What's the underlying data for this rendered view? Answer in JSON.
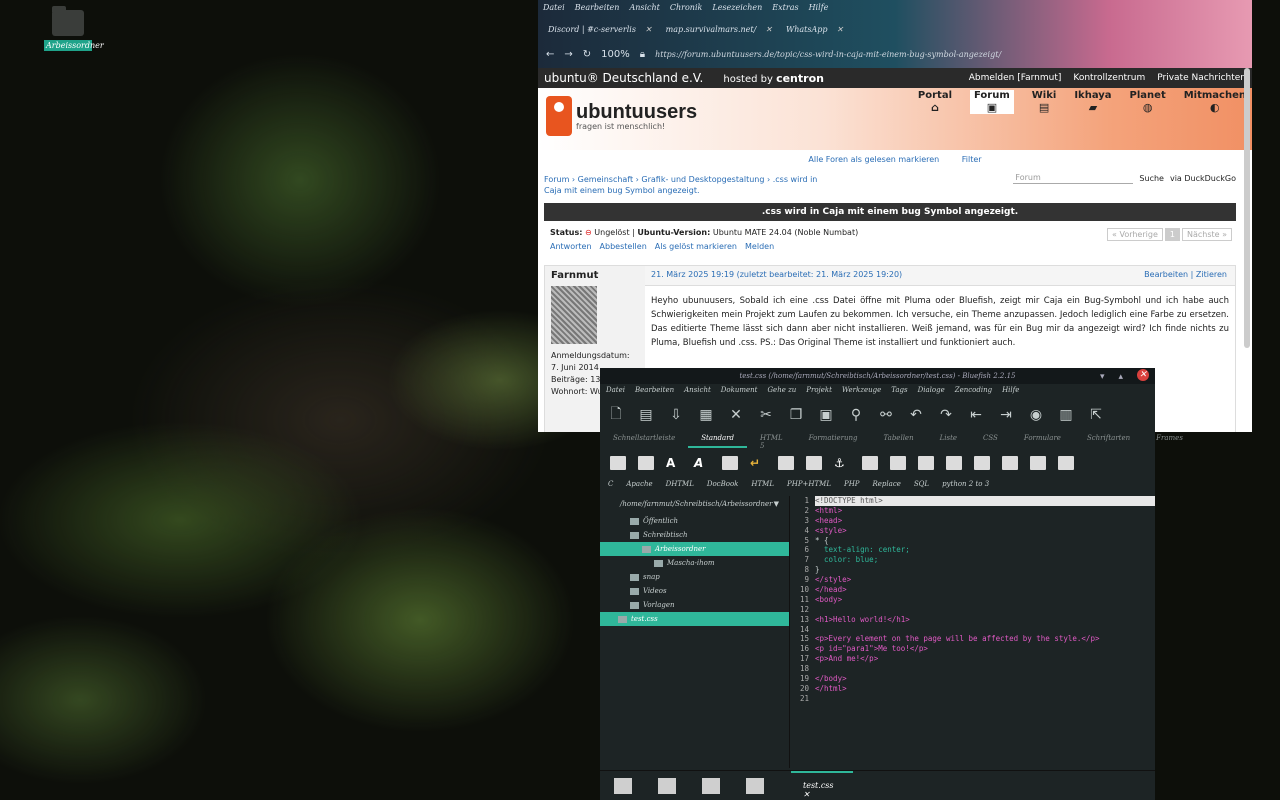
{
  "desktop": {
    "folder_label": "Arbeissordner"
  },
  "firefox": {
    "menu": [
      "Datei",
      "Bearbeiten",
      "Ansicht",
      "Chronik",
      "Lesezeichen",
      "Extras",
      "Hilfe"
    ],
    "tabs": [
      {
        "label": "Discord | #c-serverlis"
      },
      {
        "label": "map.survivalmars.net/"
      },
      {
        "label": "WhatsApp"
      }
    ],
    "zoom": "100%",
    "url": "https://forum.ubuntuusers.de/topic/css-wird-in-caja-mit-einem-bug-symbol-angezeigt/"
  },
  "site": {
    "brand": "ubuntu® Deutschland e.V.",
    "hosted_by": "hosted by",
    "host": "centron",
    "topright": [
      "Abmelden [Farnmut]",
      "Kontrollzentrum",
      "Private Nachrichten"
    ],
    "logo_name": "ubuntuusers",
    "logo_slogan": "fragen ist menschlich!",
    "nav": [
      {
        "label": "Portal",
        "icon": "⌂"
      },
      {
        "label": "Forum",
        "icon": "▣"
      },
      {
        "label": "Wiki",
        "icon": "▤"
      },
      {
        "label": "Ikhaya",
        "icon": "▰"
      },
      {
        "label": "Planet",
        "icon": "◍"
      },
      {
        "label": "Mitmachen",
        "icon": "◐"
      }
    ],
    "mark_read": "Alle Foren als gelesen markieren",
    "filter": "Filter",
    "breadcrumbs": "Forum › Gemeinschaft › Grafik- und Desktopgestaltung › .css wird in Caja mit einem bug Symbol angezeigt.",
    "search_placeholder": "Forum",
    "search_label": "Suche",
    "search_engine": "via DuckDuckGo",
    "thread_title": ".css wird in Caja mit einem bug Symbol angezeigt.",
    "status_label": "Status:",
    "status_value": "Ungelöst",
    "version_label": "Ubuntu-Version:",
    "version_value": "Ubuntu MATE 24.04 (Noble Numbat)",
    "actions": [
      "Antworten",
      "Abbestellen",
      "Als gelöst markieren",
      "Melden"
    ],
    "pager": [
      "« Vorherige",
      "1",
      "Nächste »"
    ],
    "post": {
      "author": "Farnmut",
      "reg_label": "Anmeldungsdatum:",
      "reg_date": "7. Juni 2014",
      "posts": "Beiträge: 13",
      "home": "Wohnort: Wu",
      "date": "21. März 2025 19:19 (zuletzt bearbeitet: 21. März 2025 19:20)",
      "edit": "Bearbeiten",
      "quote": "Zitieren",
      "body": "Heyho ubunuusers, Sobald ich eine .css Datei öffne mit Pluma oder Bluefish, zeigt mir Caja ein Bug-Symbohl und ich habe auch Schwierigkeiten mein Projekt zum Laufen zu bekommen. Ich versuche, ein Theme anzupassen. Jedoch lediglich eine Farbe zu ersetzen. Das editierte Theme lässt sich dann aber nicht installieren. Weiß jemand, was für ein Bug mir da angezeigt wird? Ich finde nichts zu Pluma, Bluefish und .css. PS.: Das Original Theme ist installiert und funktioniert auch."
    }
  },
  "bluefish": {
    "title": "test.css (/home/farnmut/Schreibtisch/Arbeissordner/test.css) - Bluefish 2.2.15",
    "menu": [
      "Datei",
      "Bearbeiten",
      "Ansicht",
      "Dokument",
      "Gehe zu",
      "Projekt",
      "Werkzeuge",
      "Tags",
      "Dialoge",
      "Zencoding",
      "Hilfe"
    ],
    "tabs": [
      "Schnellstartleiste",
      "Standard",
      "HTML 5",
      "Formatierung",
      "Tabellen",
      "Liste",
      "CSS",
      "Formulare",
      "Schriftarten",
      "Frames"
    ],
    "langs": [
      "C",
      "Apache",
      "DHTML",
      "DocBook",
      "HTML",
      "PHP+HTML",
      "PHP",
      "Replace",
      "SQL",
      "python 2 to 3"
    ],
    "path": "/home/farnmut/Schreibtisch/Arbeissordner",
    "tree": [
      {
        "label": "Öffentlich",
        "indent": 1
      },
      {
        "label": "Schreibtisch",
        "indent": 1
      },
      {
        "label": "Arbeissordner",
        "indent": 2,
        "sel": true
      },
      {
        "label": "Mascha-ihom",
        "indent": 3
      },
      {
        "label": "snap",
        "indent": 1
      },
      {
        "label": "Videos",
        "indent": 1
      },
      {
        "label": "Vorlagen",
        "indent": 1
      },
      {
        "label": "test.css",
        "indent": 0,
        "sel": true
      }
    ],
    "lines": [
      "<!DOCTYPE html>",
      "<html>",
      "<head>",
      "<style>",
      "* {",
      "  text-align: center;",
      "  color: blue;",
      "}",
      "</style>",
      "</head>",
      "<body>",
      "",
      "<h1>Hello world!</h1>",
      "",
      "<p>Every element on the page will be affected by the style.</p>",
      "<p id=\"para1\">Me too!</p>",
      "<p>And me!</p>",
      "",
      "</body>",
      "</html>",
      ""
    ],
    "file_tab": "test.css"
  }
}
